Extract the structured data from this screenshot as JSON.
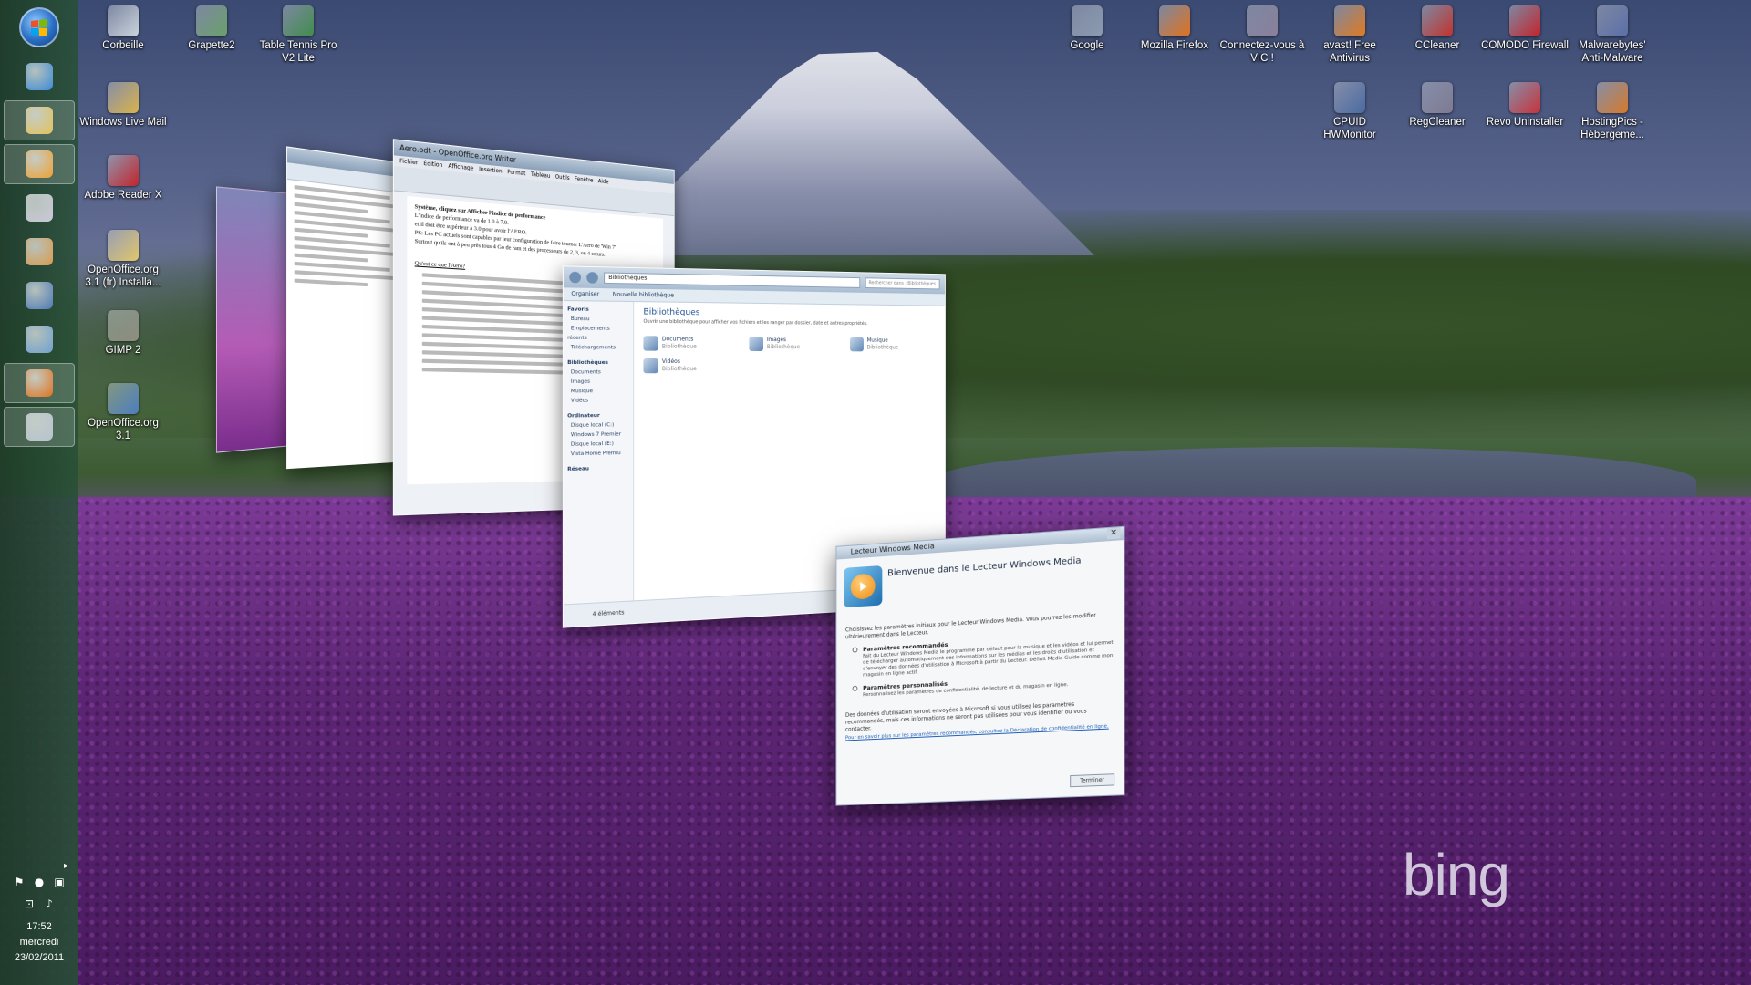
{
  "desktop": {
    "icons_left": [
      {
        "label": "Corbeille",
        "icon": "recycle-bin-icon",
        "color": "#c9d3dc"
      },
      {
        "label": "Grapette2",
        "icon": "app-icon",
        "color": "#6aa06a"
      },
      {
        "label": "Table Tennis Pro V2 Lite",
        "icon": "game-icon",
        "color": "#3f8d4b"
      },
      {
        "label": "Windows Live Mail",
        "icon": "mail-icon",
        "color": "#d9b24a"
      },
      {
        "label": "Adobe Reader X",
        "icon": "pdf-icon",
        "color": "#c3242a"
      },
      {
        "label": "OpenOffice.org 3.1 (fr) Installa...",
        "icon": "folder-icon",
        "color": "#e1c66a"
      },
      {
        "label": "GIMP 2",
        "icon": "gimp-icon",
        "color": "#8d8d80"
      },
      {
        "label": "OpenOffice.org 3.1",
        "icon": "openoffice-icon",
        "color": "#4c7fbf"
      }
    ],
    "icons_right": [
      {
        "label": "Google",
        "icon": "google-icon",
        "color": "#8a9bb0"
      },
      {
        "label": "Mozilla Firefox",
        "icon": "firefox-icon",
        "color": "#e0721d"
      },
      {
        "label": "Connectez-vous à VIC !",
        "icon": "connect-icon",
        "color": "#8a7f9a"
      },
      {
        "label": "avast! Free Antivirus",
        "icon": "avast-icon",
        "color": "#e07a1f"
      },
      {
        "label": "CCleaner",
        "icon": "ccleaner-icon",
        "color": "#c2322c"
      },
      {
        "label": "COMODO Firewall",
        "icon": "comodo-icon",
        "color": "#c4232b"
      },
      {
        "label": "Malwarebytes' Anti-Malware",
        "icon": "malwarebytes-icon",
        "color": "#5a6fa8"
      },
      {
        "label": "CPUID HWMonitor",
        "icon": "hwmonitor-icon",
        "color": "#4a6aa0"
      },
      {
        "label": "RegCleaner",
        "icon": "regcleaner-icon",
        "color": "#7e7a92"
      },
      {
        "label": "Revo Uninstaller",
        "icon": "revo-icon",
        "color": "#c7323b"
      },
      {
        "label": "HostingPics - Hébergeme...",
        "icon": "hostingpics-icon",
        "color": "#d47a2a"
      }
    ],
    "brand_watermark": "bing"
  },
  "taskbar": {
    "buttons": [
      {
        "icon": "internet-explorer-icon",
        "color": "#3b8ad8"
      },
      {
        "icon": "windows-explorer-icon",
        "color": "#e2c25a"
      },
      {
        "icon": "media-player-icon",
        "color": "#f0a030"
      },
      {
        "icon": "paint-icon",
        "color": "#c9c9d6"
      },
      {
        "icon": "paint-palette-icon",
        "color": "#d99a4c"
      },
      {
        "icon": "remote-desktop-icon",
        "color": "#4d79b7"
      },
      {
        "icon": "switch-windows-icon",
        "color": "#6fa0cf"
      },
      {
        "icon": "firefox-icon",
        "color": "#e0721d"
      },
      {
        "icon": "documents-icon",
        "color": "#b7c3cf"
      }
    ],
    "clock": {
      "time": "17:52",
      "day": "mercredi",
      "date": "23/02/2011"
    }
  },
  "flip3d": {
    "writer_window": {
      "title": "Aero.odt - OpenOffice.org Writer",
      "menu": [
        "Fichier",
        "Édition",
        "Affichage",
        "Insertion",
        "Format",
        "Tableau",
        "Outils",
        "Fenêtre",
        "Aide"
      ],
      "heading": "Système, cliquez sur Afficher l'indice de performance",
      "lines": [
        "L'indice de performance va de 1.0 à 7.9.",
        "et il doit être supérieur à 3.0 pour avoir l'AERO.",
        "PS: Les PC actuels sont capables par leur configuration de faire tourner L'Aero de 'Win 7'",
        "Surtout qu'ils ont à peu près tous 4 Go de ram et des processeurs de 2, 3, ou 4 cœurs.",
        "Qu'est ce que l'Aero?"
      ]
    },
    "explorer_window": {
      "breadcrumb": "Bibliothèques",
      "search_placeholder": "Rechercher dans : Bibliothèques",
      "toolbar": [
        "Organiser",
        "Nouvelle bibliothèque"
      ],
      "nav_favorites": [
        "Favoris",
        "Bureau",
        "Emplacements récents",
        "Téléchargements"
      ],
      "nav_libraries": [
        "Bibliothèques",
        "Documents",
        "Images",
        "Musique",
        "Vidéos"
      ],
      "nav_computer": [
        "Ordinateur",
        "Disque local (C:)",
        "Windows 7 Premier",
        "Disque local (E:)",
        "Vista Home Premiu"
      ],
      "nav_network": "Réseau",
      "heading": "Bibliothèques",
      "subheading": "Ouvrir une bibliothèque pour afficher vos fichiers et les ranger par dossier, date et autres propriétés.",
      "libraries": [
        {
          "name": "Documents",
          "type": "Bibliothèque"
        },
        {
          "name": "Images",
          "type": "Bibliothèque"
        },
        {
          "name": "Musique",
          "type": "Bibliothèque"
        },
        {
          "name": "Vidéos",
          "type": "Bibliothèque"
        }
      ],
      "status": "4 éléments"
    },
    "wmp_dialog": {
      "title": "Lecteur Windows Media",
      "heading": "Bienvenue dans le Lecteur Windows Media",
      "intro": "Choisissez les paramètres initiaux pour le Lecteur Windows Media. Vous pourrez les modifier ultérieurement dans le Lecteur.",
      "option1_label": "Paramètres recommandés",
      "option1_desc": "Fait du Lecteur Windows Media le programme par défaut pour la musique et les vidéos et lui permet de télécharger automatiquement des informations sur les médias et les droits d'utilisation et d'envoyer des données d'utilisation à Microsoft à partir du Lecteur. Définit Media Guide comme mon magasin en ligne actif.",
      "option2_label": "Paramètres personnalisés",
      "option2_desc": "Personnalisez les paramètres de confidentialité, de lecture et du magasin en ligne.",
      "notice": "Des données d'utilisation seront envoyées à Microsoft si vous utilisez les paramètres recommandés, mais ces informations ne seront pas utilisées pour vous identifier ou vous contacter.",
      "link": "Pour en savoir plus sur les paramètres recommandés, consultez la Déclaration de confidentialité en ligne.",
      "button": "Terminer"
    }
  }
}
